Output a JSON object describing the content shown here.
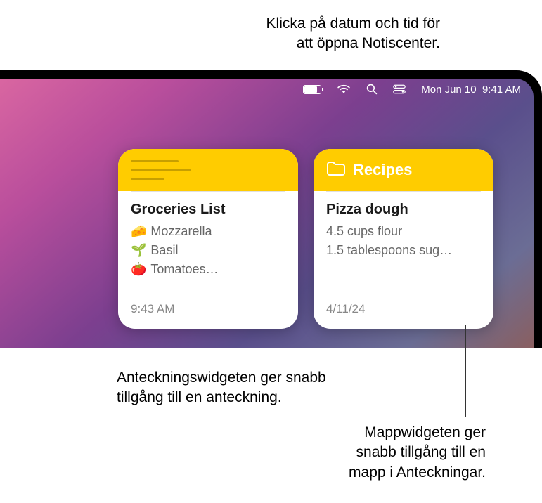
{
  "callouts": {
    "top": "Klicka på datum och tid för\natt öppna Notiscenter.",
    "bottom1": "Anteckningswidgeten ger snabb\ntillgång till en anteckning.",
    "bottom2": "Mappwidgeten ger\nsnabb tillgång till en\nmapp i Anteckningar."
  },
  "menubar": {
    "datetime": "Mon Jun 10  9:41 AM"
  },
  "widgets": {
    "note": {
      "title": "Groceries List",
      "items": [
        {
          "emoji": "🧀",
          "text": "Mozzarella"
        },
        {
          "emoji": "🌱",
          "text": "Basil"
        },
        {
          "emoji": "🍅",
          "text": "Tomatoes…"
        }
      ],
      "timestamp": "9:43 AM"
    },
    "folder": {
      "header": "Recipes",
      "title": "Pizza dough",
      "lines": [
        "4.5 cups flour",
        "1.5 tablespoons sug…"
      ],
      "timestamp": "4/11/24"
    }
  }
}
